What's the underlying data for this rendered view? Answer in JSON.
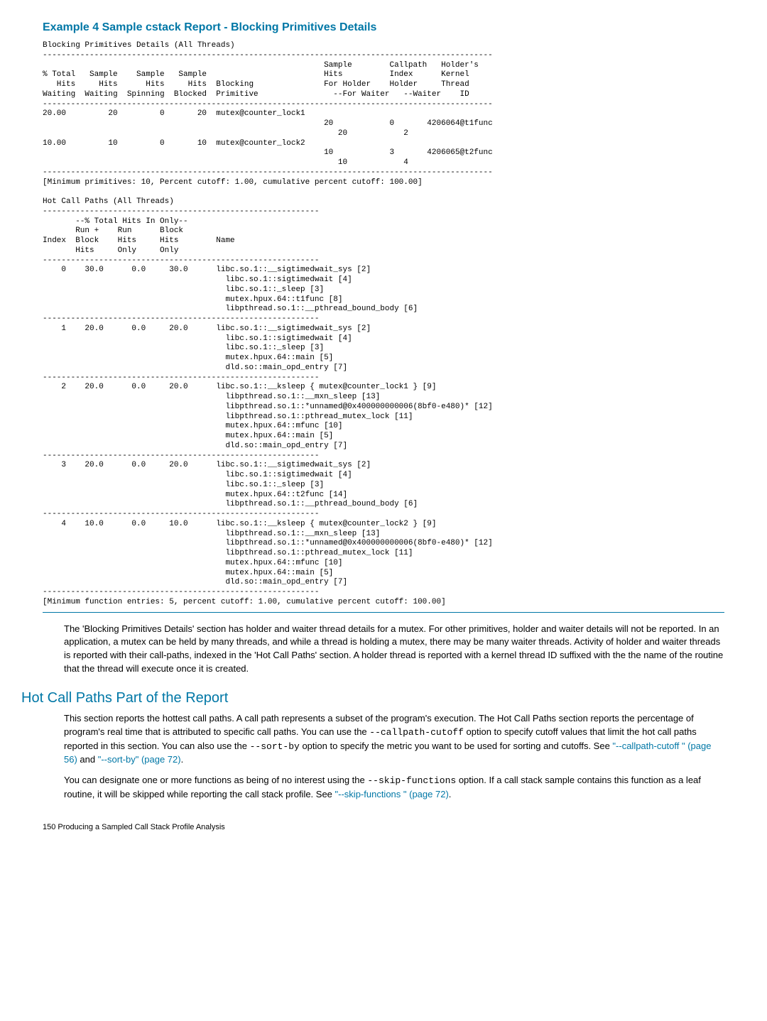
{
  "example_title": "Example 4 Sample cstack Report - Blocking Primitives Details",
  "code_block": "Blocking Primitives Details (All Threads)\n------------------------------------------------------------------------------------------------\n                                                            Sample        Callpath   Holder's\n% Total   Sample    Sample   Sample                         Hits          Index      Kernel\n   Hits     Hits      Hits     Hits  Blocking               For Holder    Holder     Thread\nWaiting  Waiting  Spinning  Blocked  Primitive                --For Waiter   --Waiter    ID\n------------------------------------------------------------------------------------------------\n20.00         20         0       20  mutex@counter_lock1\n                                                            20            0       4206064@t1func\n                                                               20            2\n10.00         10         0       10  mutex@counter_lock2\n                                                            10            3       4206065@t2func\n                                                               10            4\n------------------------------------------------------------------------------------------------\n[Minimum primitives: 10, Percent cutoff: 1.00, cumulative percent cutoff: 100.00]\n\nHot Call Paths (All Threads)\n-----------------------------------------------------------\n       --% Total Hits In Only--\n       Run +    Run      Block\nIndex  Block    Hits     Hits        Name\n       Hits     Only     Only\n-----------------------------------------------------------\n    0    30.0      0.0     30.0      libc.so.1::__sigtimedwait_sys [2]\n                                       libc.so.1::sigtimedwait [4]\n                                       libc.so.1::_sleep [3]\n                                       mutex.hpux.64::t1func [8]\n                                       libpthread.so.1::__pthread_bound_body [6]\n-----------------------------------------------------------\n    1    20.0      0.0     20.0      libc.so.1::__sigtimedwait_sys [2]\n                                       libc.so.1::sigtimedwait [4]\n                                       libc.so.1::_sleep [3]\n                                       mutex.hpux.64::main [5]\n                                       dld.so::main_opd_entry [7]\n-----------------------------------------------------------\n    2    20.0      0.0     20.0      libc.so.1::__ksleep { mutex@counter_lock1 } [9]\n                                       libpthread.so.1::__mxn_sleep [13]\n                                       libpthread.so.1::*unnamed@0x400000000006(8bf0-e480)* [12]\n                                       libpthread.so.1::pthread_mutex_lock [11]\n                                       mutex.hpux.64::mfunc [10]\n                                       mutex.hpux.64::main [5]\n                                       dld.so::main_opd_entry [7]\n-----------------------------------------------------------\n    3    20.0      0.0     20.0      libc.so.1::__sigtimedwait_sys [2]\n                                       libc.so.1::sigtimedwait [4]\n                                       libc.so.1::_sleep [3]\n                                       mutex.hpux.64::t2func [14]\n                                       libpthread.so.1::__pthread_bound_body [6]\n-----------------------------------------------------------\n    4    10.0      0.0     10.0      libc.so.1::__ksleep { mutex@counter_lock2 } [9]\n                                       libpthread.so.1::__mxn_sleep [13]\n                                       libpthread.so.1::*unnamed@0x400000000006(8bf0-e480)* [12]\n                                       libpthread.so.1::pthread_mutex_lock [11]\n                                       mutex.hpux.64::mfunc [10]\n                                       mutex.hpux.64::main [5]\n                                       dld.so::main_opd_entry [7]\n-----------------------------------------------------------\n[Minimum function entries: 5, percent cutoff: 1.00, cumulative percent cutoff: 100.00]",
  "para1_a": "The 'Blocking Primitives Details' section has holder and waiter thread details for a mutex. For other primitives, holder and waiter details will not be reported. In an application, a mutex can be held by many threads, and while a thread is holding a mutex, there may be many waiter threads. Activity of holder and waiter threads is reported with their call-paths, indexed in the 'Hot Call Paths' section. A holder thread is reported with a kernel thread ID suffixed with the the name of the routine that the thread will execute once it is created.",
  "section_title": "Hot Call Paths Part of the Report",
  "para2_a": "This section reports the hottest call paths. A call path represents a subset of the program's execution. The Hot Call Paths section reports the percentage of program's real time that is attributed to specific call paths. You can use the ",
  "para2_mono1": "--callpath-cutoff",
  "para2_b": " option to specify cutoff values that limit the hot call paths reported in this section. You can also use the ",
  "para2_mono2": "--sort-by",
  "para2_c": " option to specify the metric you want to be used for sorting and cutoffs. See ",
  "para2_link1": "\"--callpath-cutoff \" (page 56)",
  "para2_d": " and ",
  "para2_link2": "\"--sort-by\" (page 72)",
  "para2_e": ".",
  "para3_a": "You can designate one or more functions as being of no interest using the ",
  "para3_mono1": "--skip-functions",
  "para3_b": " option. If a call stack sample contains this function as a leaf routine, it will be skipped while reporting the call stack profile. See ",
  "para3_link1": "\"--skip-functions \" (page 72)",
  "para3_c": ".",
  "footer": "150   Producing a Sampled Call Stack Profile Analysis"
}
